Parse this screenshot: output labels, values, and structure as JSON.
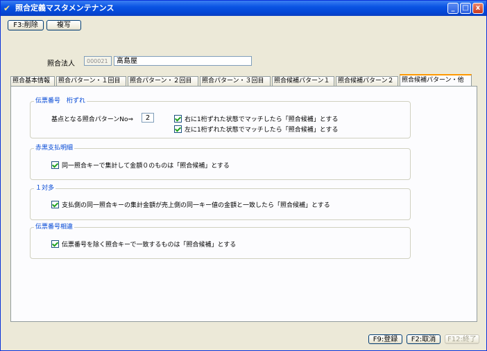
{
  "window": {
    "title": "照合定義マスタメンテナンス",
    "minimize": "_",
    "maximize": "□",
    "close": "x",
    "icon": "✔"
  },
  "toolbar": {
    "delete_label": "F3:削除",
    "copy_label": "複写"
  },
  "header": {
    "entity_label": "照合法人",
    "entity_code": "000021",
    "entity_name": "髙島屋"
  },
  "tabs": [
    {
      "label": "照合基本情報",
      "active": false
    },
    {
      "label": "照合パターン・１回目",
      "active": false
    },
    {
      "label": "照合パターン・２回目",
      "active": false
    },
    {
      "label": "照合パターン・３回目",
      "active": false
    },
    {
      "label": "照合候補パターン１",
      "active": false
    },
    {
      "label": "照合候補パターン２",
      "active": false
    },
    {
      "label": "照合候補パターン・他",
      "active": true
    }
  ],
  "groups": {
    "digit_shift": {
      "title": "伝票番号　桁ずれ",
      "base_label": "基点となる照合パターンNo⇒",
      "base_value": "2",
      "opt_right": "右に1桁ずれた状態でマッチしたら「照合候補」とする",
      "opt_left": "左に1桁ずれた状態でマッチしたら「照合候補」とする"
    },
    "red_black": {
      "title": "赤黒支払明細",
      "opt": "同一照合キーで集計して金額０のものは「照合候補」とする"
    },
    "one_to_many": {
      "title": "１対多",
      "opt": "支払側の同一照合キーの集計金額が売上側の同一キー値の金額と一致したら「照合候補」とする"
    },
    "slip_diff": {
      "title": "伝票番号相違",
      "opt": "伝票番号を除く照合キーで一致するものは「照合候補」とする"
    }
  },
  "footer": {
    "register_label": "F9:登録",
    "cancel_label": "F2:取消",
    "exit_label": "F12:終了"
  },
  "colors": {
    "title_bar": "#0a54e3",
    "group_title": "#0046d5",
    "active_tab_accent": "#ff9900",
    "check_mark": "#21a121"
  }
}
